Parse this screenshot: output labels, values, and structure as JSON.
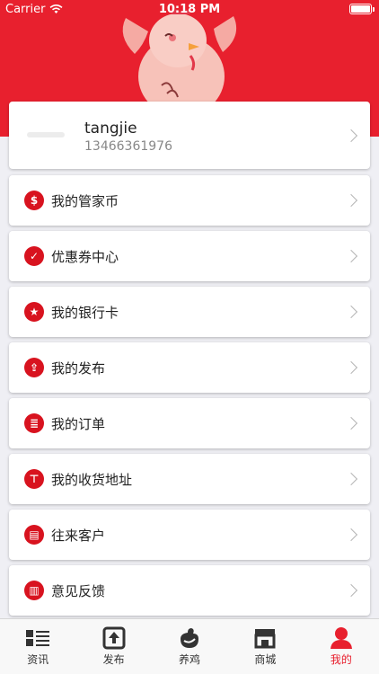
{
  "status_bar": {
    "carrier": "Carrier",
    "time": "10:18 PM"
  },
  "profile": {
    "username": "tangjie",
    "phone": "13466361976"
  },
  "menu": [
    {
      "label": "我的管家币",
      "icon": "dollar-icon",
      "glyph": "$"
    },
    {
      "label": "优惠券中心",
      "icon": "coupon-icon",
      "glyph": "✓"
    },
    {
      "label": "我的银行卡",
      "icon": "star-icon",
      "glyph": "★"
    },
    {
      "label": "我的发布",
      "icon": "publish-icon",
      "glyph": "⇪"
    },
    {
      "label": "我的订单",
      "icon": "order-icon",
      "glyph": "≣"
    },
    {
      "label": "我的收货地址",
      "icon": "address-sign-icon",
      "glyph": "⊤"
    },
    {
      "label": "往来客户",
      "icon": "customer-doc-icon",
      "glyph": "▤"
    },
    {
      "label": "意见反馈",
      "icon": "feedback-clipboard-icon",
      "glyph": "▥"
    }
  ],
  "tabs": [
    {
      "label": "资讯",
      "icon": "news-list-icon",
      "active": false
    },
    {
      "label": "发布",
      "icon": "publish-upload-icon",
      "active": false
    },
    {
      "label": "养鸡",
      "icon": "chicken-icon",
      "active": false
    },
    {
      "label": "商城",
      "icon": "store-icon",
      "active": false
    },
    {
      "label": "我的",
      "icon": "profile-person-icon",
      "active": true
    }
  ],
  "colors": {
    "accent": "#e8202e",
    "icon_red": "#d8131f",
    "background": "#efeff4"
  }
}
